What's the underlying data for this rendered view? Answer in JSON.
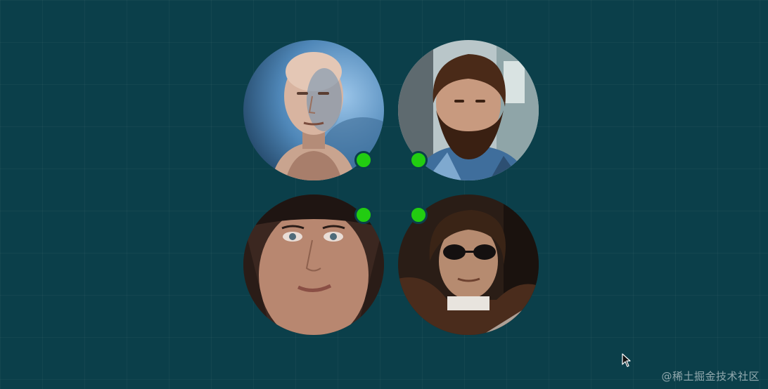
{
  "colors": {
    "background": "#0b3f4a",
    "status_online": "#22cc11"
  },
  "avatars": [
    {
      "id": "avatar-1",
      "status": "online"
    },
    {
      "id": "avatar-2",
      "status": "online"
    },
    {
      "id": "avatar-3",
      "status": "online"
    },
    {
      "id": "avatar-4",
      "status": "online"
    }
  ],
  "watermark": {
    "text": "@稀土掘金技术社区"
  },
  "icons": {
    "cursor": "mouse-pointer-icon"
  }
}
